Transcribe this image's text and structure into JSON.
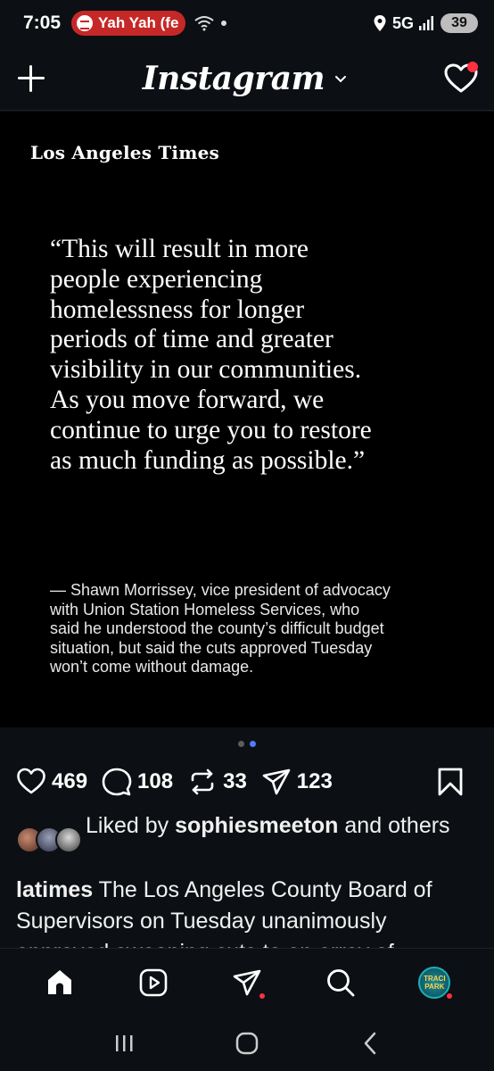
{
  "status_bar": {
    "time": "7:05",
    "media_app": "Yah Yah (fe",
    "network": "5G",
    "battery": "39"
  },
  "header": {
    "app_name": "Instagram"
  },
  "post": {
    "masthead": "Los Angeles Times",
    "quote_lines": [
      "“This will result in more",
      "people experiencing",
      "homelessness for longer",
      "periods of time and greater",
      "visibility in our communities.",
      "As you move forward, we",
      "continue to urge you to restore",
      "as much funding as possible.”"
    ],
    "attribution_lines": [
      "— Shawn Morrissey, vice president of advocacy",
      "with Union Station Homeless Services, who",
      "said he understood the county’s difficult budget",
      "situation, but said the cuts approved Tuesday",
      "won’t come without damage."
    ],
    "carousel": {
      "count": 2,
      "active_index": 1
    },
    "likes_count": "469",
    "comments_count": "108",
    "reposts_count": "33",
    "shares_count": "123",
    "liked_by_prefix": "Liked by",
    "liked_by_user": "sophiesmeeton",
    "liked_by_suffix": "and others",
    "caption_user": "latimes",
    "caption_text": "The Los Angeles County Board of Supervisors on Tuesday unanimously approved sweeping cuts to an array of"
  },
  "bottom_nav": {
    "profile_text_1": "TRACI",
    "profile_text_2": "PARK"
  },
  "colors": {
    "background": "#0c1014",
    "notification": "#ff3040",
    "active_dot": "#4f7cff",
    "media_pill": "#c62828"
  },
  "icons": [
    "plus-icon",
    "chevron-down-icon",
    "heart-icon",
    "comment-icon",
    "repost-icon",
    "share-icon",
    "bookmark-icon",
    "home-icon",
    "reels-icon",
    "direct-icon",
    "search-icon",
    "recent-apps-icon",
    "home-system-icon",
    "back-icon"
  ]
}
